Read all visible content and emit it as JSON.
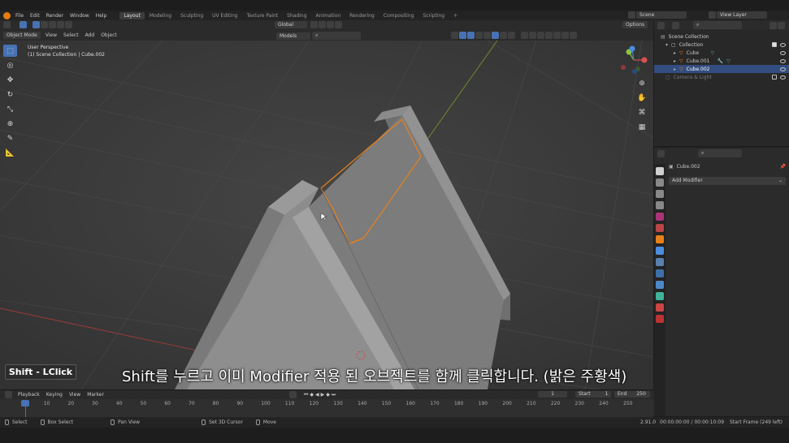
{
  "menu": [
    "File",
    "Edit",
    "Render",
    "Window",
    "Help"
  ],
  "workspaces": [
    {
      "label": "Layout",
      "active": true
    },
    {
      "label": "Modeling"
    },
    {
      "label": "Sculpting"
    },
    {
      "label": "UV Editing"
    },
    {
      "label": "Texture Paint"
    },
    {
      "label": "Shading"
    },
    {
      "label": "Animation"
    },
    {
      "label": "Rendering"
    },
    {
      "label": "Compositing"
    },
    {
      "label": "Scripting"
    }
  ],
  "add_tab": "+",
  "scene": "Scene",
  "view_layer": "View Layer",
  "viewport_header": {
    "mode": "Object Mode",
    "view": "View",
    "select": "Select",
    "add": "Add",
    "object": "Object",
    "transform": "Global",
    "collection_filter": "Models",
    "options": "Options"
  },
  "overlay": {
    "perspective": "User Perspective",
    "collection": "(1) Scene Collection | Cube.002"
  },
  "caption": {
    "key": "Shift - LClick",
    "text": "Shift를 누르고 이미 Modifier 적용 된 오브젝트를 함께 클릭합니다. (밝은 주황색)"
  },
  "timeline": {
    "playback": "Playback",
    "keying": "Keying",
    "view": "View",
    "marker": "Marker",
    "current_frame": "1",
    "start_label": "Start",
    "start": "1",
    "end_label": "End",
    "end": "250",
    "ruler": [
      "1",
      "10",
      "20",
      "30",
      "40",
      "50",
      "60",
      "70",
      "80",
      "90",
      "100",
      "110",
      "120",
      "130",
      "140",
      "150",
      "160",
      "170",
      "180",
      "190",
      "200",
      "210",
      "220",
      "230",
      "240",
      "250"
    ]
  },
  "statusbar": {
    "select": "Select",
    "box_select": "Box Select",
    "pan_view": "Pan View",
    "set_cursor": "Set 3D Cursor",
    "move": "Move",
    "version": "2.91.0",
    "time": "00:00:00:00 / 00:00:10:09",
    "frame": "Start Frame (249 left)"
  },
  "outliner": {
    "rows": [
      {
        "name": "Scene Collection",
        "indent": 0
      },
      {
        "name": "Collection",
        "indent": 1
      },
      {
        "name": "Cube",
        "indent": 2
      },
      {
        "name": "Cube.001",
        "indent": 2
      },
      {
        "name": "Cube.002",
        "indent": 2,
        "selected": true
      },
      {
        "name": "Camera & Light",
        "indent": 1,
        "dim": true
      }
    ]
  },
  "properties": {
    "object_name": "Cube.002",
    "add_modifier": "Add Modifier"
  },
  "colors": {
    "accent": "#4772b3",
    "selection_outline": "#e8801a",
    "viewport_bg": "#3d3d3d"
  }
}
